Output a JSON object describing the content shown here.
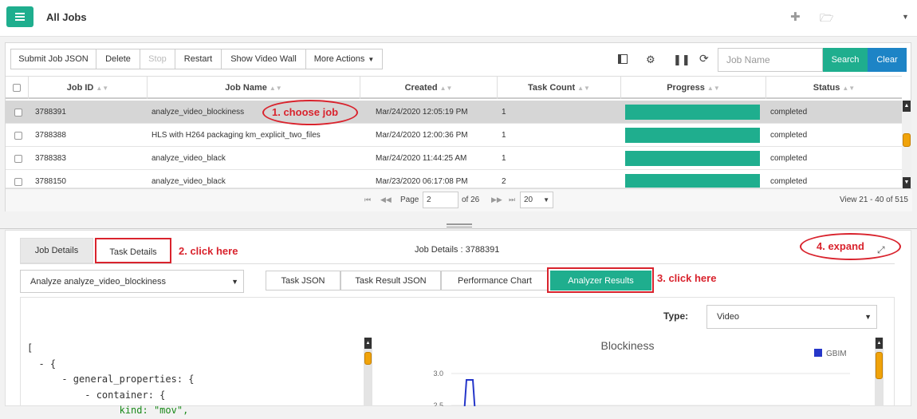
{
  "header": {
    "title": "All Jobs",
    "icons": [
      "plus-icon",
      "folder-icon",
      "caret-down-icon"
    ]
  },
  "toolbar": {
    "buttons": [
      "Submit Job JSON",
      "Delete",
      "Stop",
      "Restart",
      "Show Video Wall",
      "More Actions"
    ],
    "search_placeholder": "Job Name",
    "search_label": "Search",
    "clear_label": "Clear"
  },
  "table": {
    "columns": [
      "Job ID",
      "Job Name",
      "Created",
      "Task Count",
      "Progress",
      "Status"
    ],
    "rows": [
      {
        "id": "3788391",
        "name": "analyze_video_blockiness",
        "created": "Mar/24/2020 12:05:19 PM",
        "tasks": "1",
        "progress": 100,
        "status": "completed"
      },
      {
        "id": "3788388",
        "name": "HLS with H264 packaging km_explicit_two_files",
        "created": "Mar/24/2020 12:00:36 PM",
        "tasks": "1",
        "progress": 100,
        "status": "completed"
      },
      {
        "id": "3788383",
        "name": "analyze_video_black",
        "created": "Mar/24/2020 11:44:25 AM",
        "tasks": "1",
        "progress": 100,
        "status": "completed"
      },
      {
        "id": "3788150",
        "name": "analyze_video_black",
        "created": "Mar/23/2020 06:17:08 PM",
        "tasks": "2",
        "progress": 100,
        "status": "completed"
      }
    ]
  },
  "pager": {
    "page_label": "Page",
    "page": "2",
    "of": "of 26",
    "page_size": "20",
    "view": "View 21 - 40 of 515"
  },
  "lower": {
    "tabs": [
      "Job Details",
      "Task Details"
    ],
    "job_details_title": "Job Details : 3788391",
    "task_select": "Analyze analyze_video_blockiness",
    "subtabs": [
      "Task JSON",
      "Task Result JSON",
      "Performance Chart",
      "Analyzer Results"
    ],
    "type_label": "Type:",
    "type_value": "Video",
    "code_lines": [
      "[",
      "  - {",
      "      - general_properties: {",
      "          - container: {",
      "                kind: \"mov\","
    ],
    "chart": {
      "title": "Blockiness",
      "legend": "GBIM",
      "yticks": [
        "3.0",
        "2.5"
      ]
    }
  },
  "callouts": [
    "1. choose job",
    "2. click here",
    "3. click here",
    "4. expand"
  ],
  "colors": {
    "accent": "#1fae8e",
    "clear": "#1d84c6",
    "callout": "#d9232d",
    "series": "#2536c9"
  },
  "chart_data": {
    "type": "line",
    "title": "Blockiness",
    "series": [
      {
        "name": "GBIM",
        "values": [
          2.0,
          2.9,
          2.9,
          2.0
        ]
      }
    ],
    "ylim": [
      2.0,
      3.0
    ],
    "yticks": [
      2.5,
      3.0
    ]
  }
}
